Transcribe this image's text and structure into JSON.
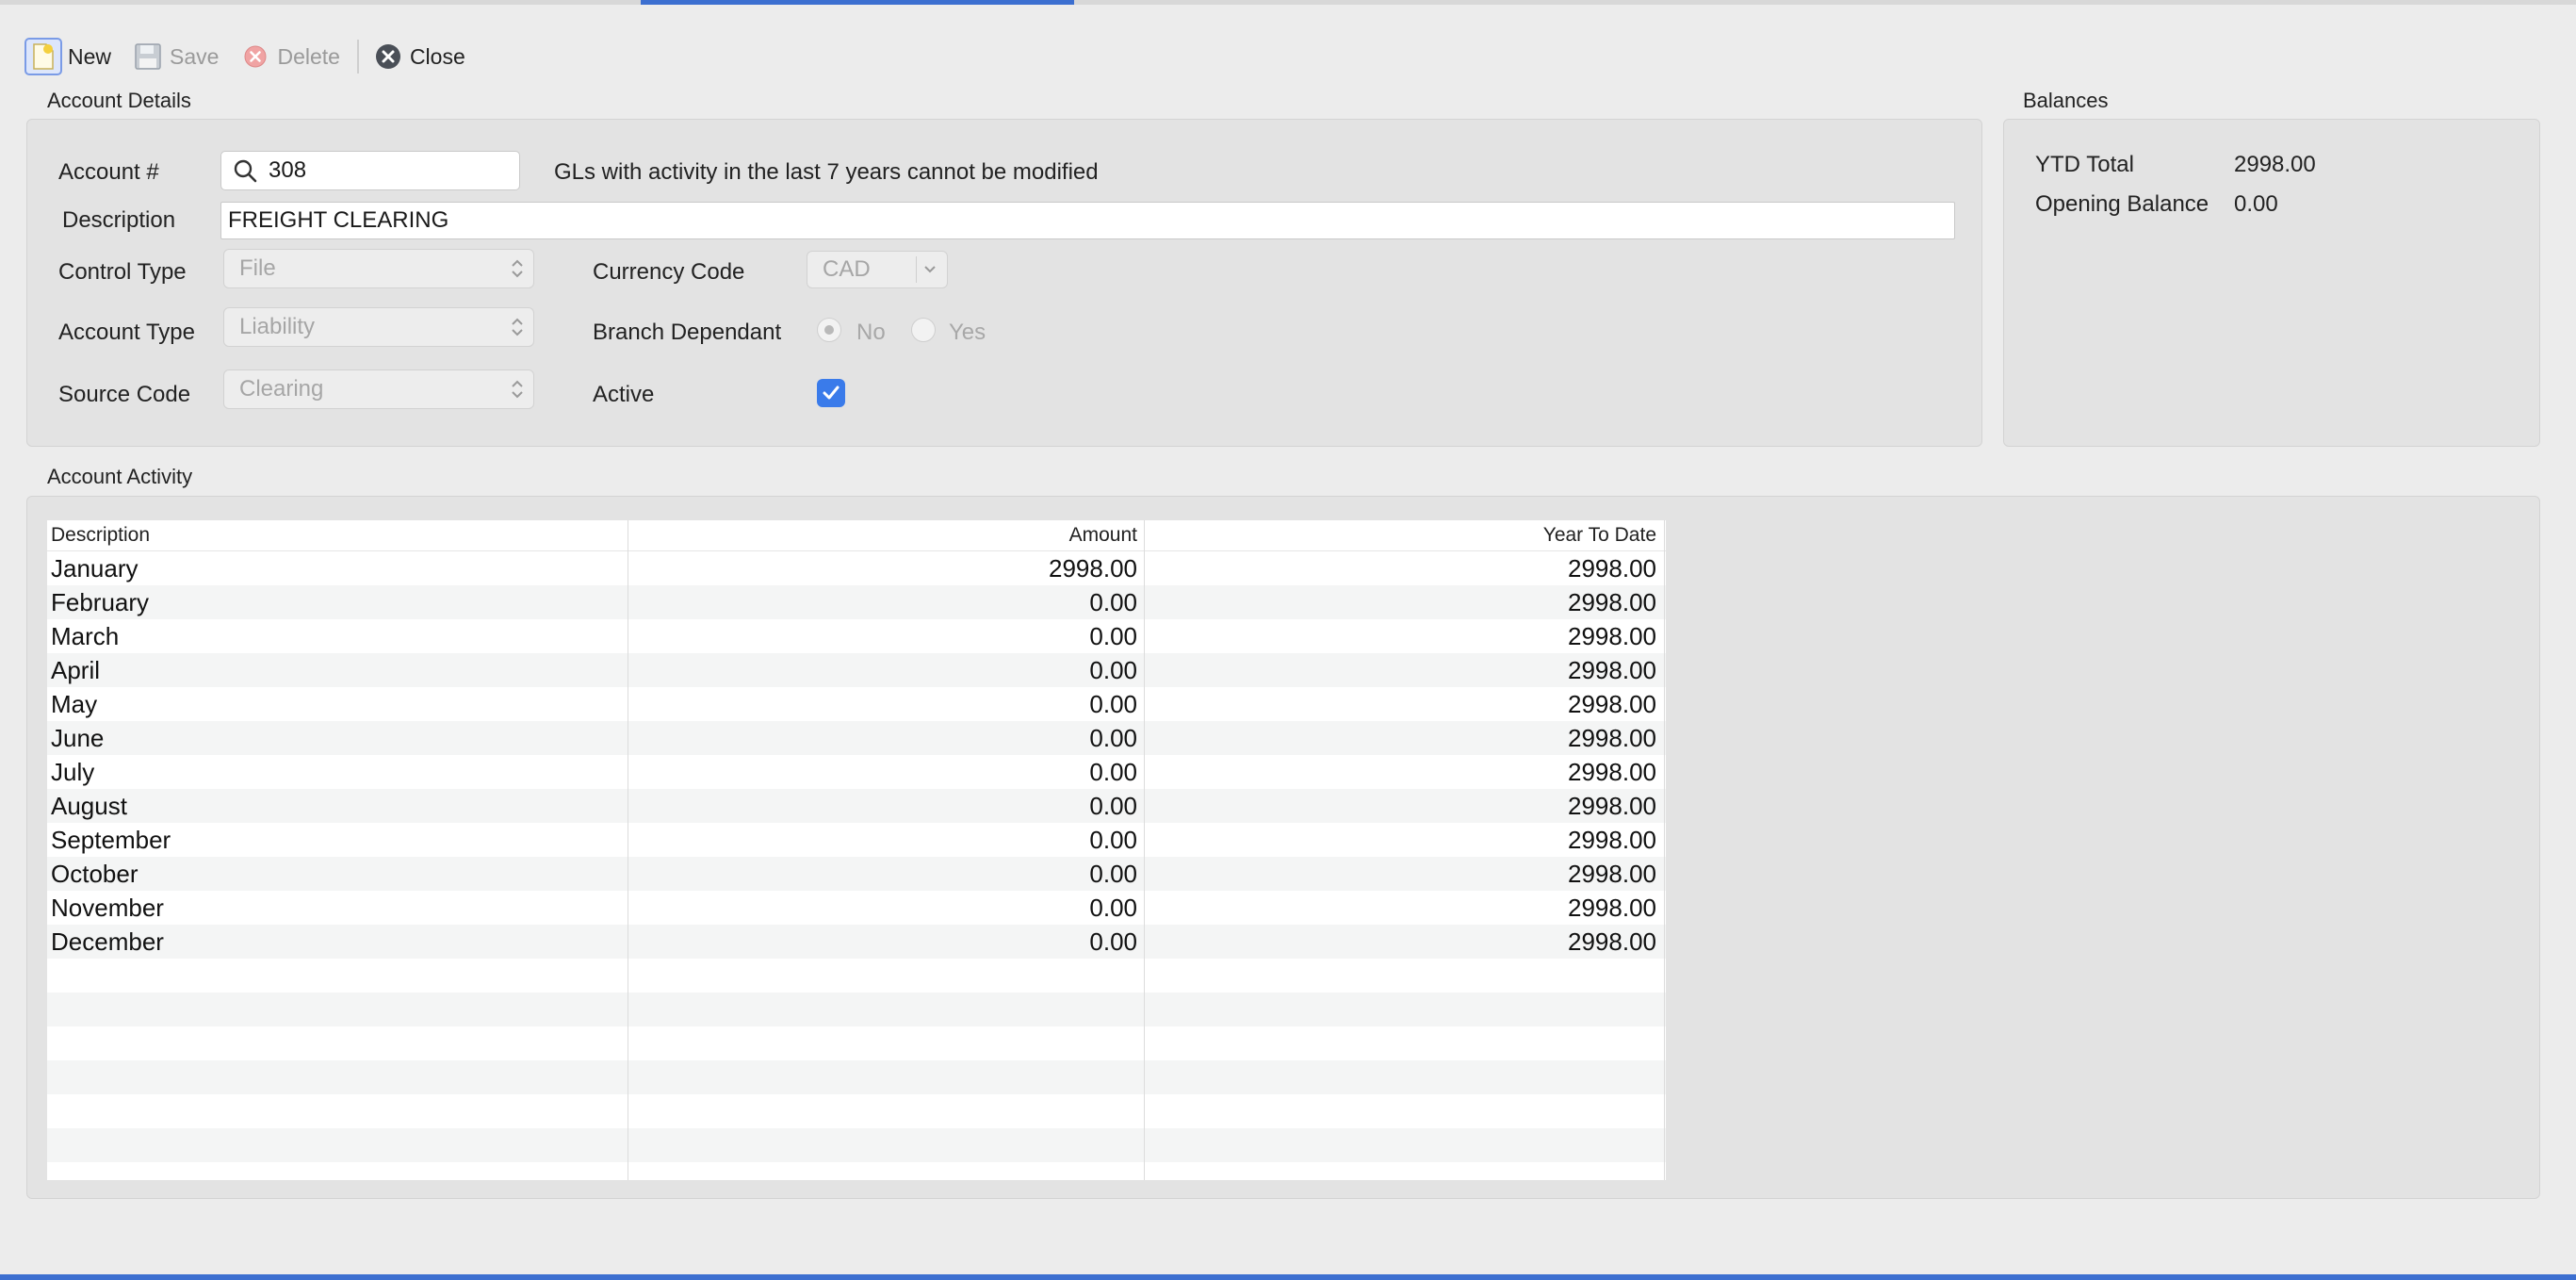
{
  "toolbar": {
    "new_label": "New",
    "save_label": "Save",
    "delete_label": "Delete",
    "close_label": "Close"
  },
  "account_details": {
    "section_title": "Account Details",
    "account_label": "Account #",
    "account_value": "308",
    "account_notice": "GLs with activity in the last 7 years cannot be modified",
    "description_label": "Description",
    "description_value": "FREIGHT CLEARING",
    "control_type_label": "Control Type",
    "control_type_value": "File",
    "account_type_label": "Account Type",
    "account_type_value": "Liability",
    "source_code_label": "Source Code",
    "source_code_value": "Clearing",
    "currency_code_label": "Currency Code",
    "currency_code_value": "CAD",
    "branch_dependant_label": "Branch Dependant",
    "branch_no_label": "No",
    "branch_yes_label": "Yes",
    "branch_selected": "No",
    "active_label": "Active",
    "active_checked": true
  },
  "balances": {
    "section_title": "Balances",
    "ytd_total_label": "YTD Total",
    "ytd_total_value": "2998.00",
    "opening_balance_label": "Opening Balance",
    "opening_balance_value": "0.00"
  },
  "activity": {
    "section_title": "Account Activity",
    "columns": [
      "Description",
      "Amount",
      "Year To Date"
    ],
    "rows": [
      {
        "description": "January",
        "amount": "2998.00",
        "ytd": "2998.00"
      },
      {
        "description": "February",
        "amount": "0.00",
        "ytd": "2998.00"
      },
      {
        "description": "March",
        "amount": "0.00",
        "ytd": "2998.00"
      },
      {
        "description": "April",
        "amount": "0.00",
        "ytd": "2998.00"
      },
      {
        "description": "May",
        "amount": "0.00",
        "ytd": "2998.00"
      },
      {
        "description": "June",
        "amount": "0.00",
        "ytd": "2998.00"
      },
      {
        "description": "July",
        "amount": "0.00",
        "ytd": "2998.00"
      },
      {
        "description": "August",
        "amount": "0.00",
        "ytd": "2998.00"
      },
      {
        "description": "September",
        "amount": "0.00",
        "ytd": "2998.00"
      },
      {
        "description": "October",
        "amount": "0.00",
        "ytd": "2998.00"
      },
      {
        "description": "November",
        "amount": "0.00",
        "ytd": "2998.00"
      },
      {
        "description": "December",
        "amount": "0.00",
        "ytd": "2998.00"
      }
    ]
  },
  "colors": {
    "accent": "#3c6fd0",
    "checkbox": "#3a7bea"
  }
}
